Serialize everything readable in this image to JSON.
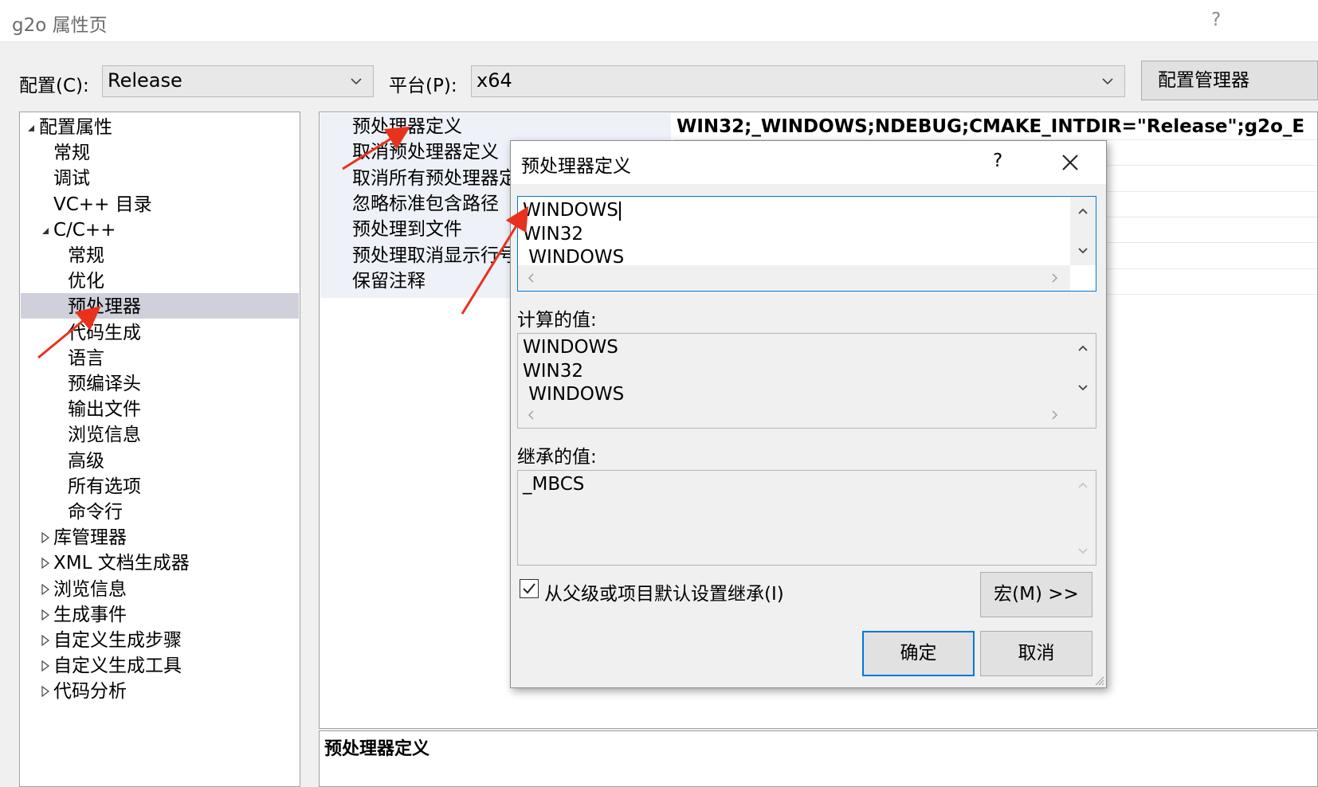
{
  "window": {
    "title": "g2o 属性页",
    "help_label": "?"
  },
  "config_row": {
    "config_label": "配置(C):",
    "config_value": "Release",
    "platform_label": "平台(P):",
    "platform_value": "x64",
    "manager_button": "配置管理器"
  },
  "tree": {
    "items": [
      {
        "label": "配置属性",
        "level": 0,
        "expander": "open"
      },
      {
        "label": "常规",
        "level": 1
      },
      {
        "label": "调试",
        "level": 1
      },
      {
        "label": "VC++ 目录",
        "level": 1
      },
      {
        "label": "C/C++",
        "level": 1,
        "expander": "open"
      },
      {
        "label": "常规",
        "level": 2
      },
      {
        "label": "优化",
        "level": 2
      },
      {
        "label": "预处理器",
        "level": 2,
        "selected": true
      },
      {
        "label": "代码生成",
        "level": 2
      },
      {
        "label": "语言",
        "level": 2
      },
      {
        "label": "预编译头",
        "level": 2
      },
      {
        "label": "输出文件",
        "level": 2
      },
      {
        "label": "浏览信息",
        "level": 2
      },
      {
        "label": "高级",
        "level": 2
      },
      {
        "label": "所有选项",
        "level": 2
      },
      {
        "label": "命令行",
        "level": 2
      },
      {
        "label": "库管理器",
        "level": 1,
        "expander": "closed"
      },
      {
        "label": "XML 文档生成器",
        "level": 1,
        "expander": "closed"
      },
      {
        "label": "浏览信息",
        "level": 1,
        "expander": "closed"
      },
      {
        "label": "生成事件",
        "level": 1,
        "expander": "closed"
      },
      {
        "label": "自定义生成步骤",
        "level": 1,
        "expander": "closed"
      },
      {
        "label": "自定义生成工具",
        "level": 1,
        "expander": "closed"
      },
      {
        "label": "代码分析",
        "level": 1,
        "expander": "closed"
      }
    ]
  },
  "properties": {
    "rows": [
      {
        "name": "预处理器定义",
        "value": "WIN32;_WINDOWS;NDEBUG;CMAKE_INTDIR=\"Release\";g2o_E"
      },
      {
        "name": "取消预处理器定义",
        "value": ""
      },
      {
        "name": "取消所有预处理器定",
        "value": ""
      },
      {
        "name": "忽略标准包含路径",
        "value": ""
      },
      {
        "name": "预处理到文件",
        "value": ""
      },
      {
        "name": "预处理取消显示行号",
        "value": ""
      },
      {
        "name": "保留注释",
        "value": ""
      }
    ],
    "description_title": "预处理器定义"
  },
  "dialog": {
    "title": "预处理器定义",
    "help_label": "?",
    "edit_lines": [
      "WINDOWS",
      "WIN32",
      " WINDOWS"
    ],
    "computed_label": "计算的值:",
    "computed_lines": [
      "WINDOWS",
      "WIN32",
      " WINDOWS"
    ],
    "inherited_label": "继承的值:",
    "inherited_lines": [
      "_MBCS"
    ],
    "inherit_checkbox_label": "从父级或项目默认设置继承(I)",
    "inherit_checked": true,
    "macro_button": "宏(M) >>",
    "ok_button": "确定",
    "cancel_button": "取消"
  },
  "colors": {
    "selection": "#cfd0dc",
    "annotation_arrow": "#e8321e",
    "focus_border": "#0078d7"
  }
}
